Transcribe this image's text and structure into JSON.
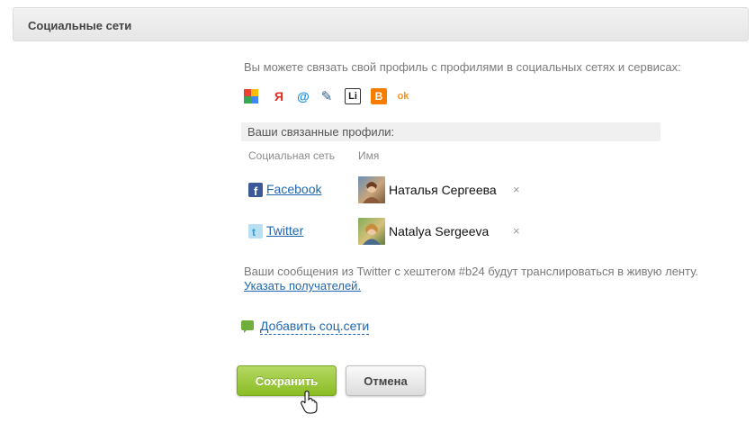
{
  "header": {
    "title": "Социальные сети"
  },
  "intro": "Вы можете связать свой профиль с профилями в социальных сетях и сервисах:",
  "services": [
    {
      "name": "google-icon",
      "glyph": "",
      "bg": "#ffffff",
      "color": "#4285f4"
    },
    {
      "name": "yandex-icon",
      "glyph": "Я",
      "bg": "#ffffff",
      "color": "#e32a1f"
    },
    {
      "name": "mailru-icon",
      "glyph": "@",
      "bg": "#ffffff",
      "color": "#168de2"
    },
    {
      "name": "livejournal-icon",
      "glyph": "✎",
      "bg": "#ffffff",
      "color": "#2d5a8a"
    },
    {
      "name": "liveinternet-icon",
      "glyph": "Li",
      "bg": "#ffffff",
      "color": "#222222"
    },
    {
      "name": "blogger-icon",
      "glyph": "B",
      "bg": "#f57d00",
      "color": "#ffffff"
    },
    {
      "name": "odnoklassniki-icon",
      "glyph": "ok",
      "bg": "#ffffff",
      "color": "#f7931e"
    }
  ],
  "linked": {
    "title": "Ваши связанные профили:",
    "col_network": "Социальная сеть",
    "col_name": "Имя",
    "rows": [
      {
        "network": "Facebook",
        "icon": "facebook-icon",
        "user": "Наталья Сергеева",
        "remove": "×"
      },
      {
        "network": "Twitter",
        "icon": "twitter-icon",
        "user": "Natalya Sergeeva",
        "remove": "×"
      }
    ]
  },
  "note": {
    "text": "Ваши сообщения из Twitter с хештегом #b24 будут транслироваться в живую ленту.",
    "link": "Указать получателей."
  },
  "add_link": "Добавить соц.сети",
  "buttons": {
    "save": "Сохранить",
    "cancel": "Отмена"
  },
  "colors": {
    "accent_link": "#2067b0",
    "save_button": "#8bbc24",
    "facebook": "#3b5998",
    "twitter": "#55acee"
  }
}
